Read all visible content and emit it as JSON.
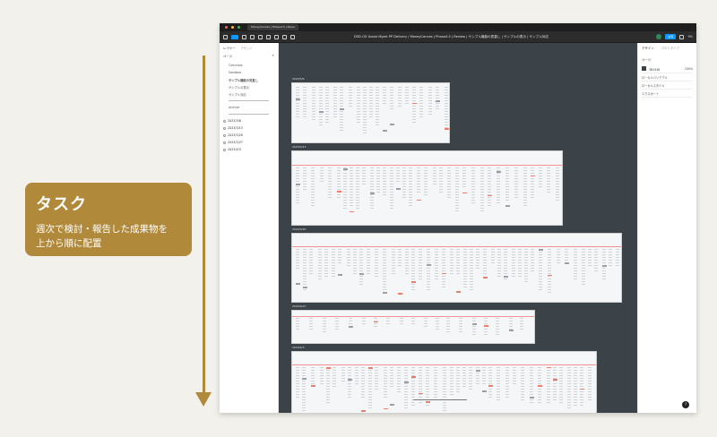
{
  "annotation": {
    "title": "タスク",
    "description_line1": "週次で検討・報告した成果物を",
    "description_line2": "上から順に配置",
    "accent_color": "#b0893a"
  },
  "window": {
    "tab_label": "MoneyCanvas | Phase4-5 | Revie",
    "file_title": "DSD-GX Assist Mgmt PP Delivery  /  MoneyCanvas | Phase4-5 | Review | サンプル機能の見直し | サンプルの表示 | サンプル対応",
    "share_label": "共有",
    "zoom": "9%"
  },
  "left_panel": {
    "tabs": [
      "レイヤー",
      "アセット"
    ],
    "active_tab": "レイヤー",
    "pages_header": "ページ",
    "add_icon": "+",
    "pages": [
      {
        "label": "Overview",
        "sub": true
      },
      {
        "label": "Sandbox",
        "sub": true
      },
      {
        "label": "サンプル機能の見直し",
        "sub": true,
        "current": true
      },
      {
        "label": "サンプルの表示",
        "sub": true
      },
      {
        "label": "サンプル対応",
        "sub": true
      }
    ],
    "archive_label": "Archive",
    "weeks": [
      "2023/3/6",
      "2023/3/13",
      "2023/3/20",
      "2023/3/27",
      "2023/4/3"
    ]
  },
  "canvas": {
    "bg_color": "#3b4348",
    "frames": [
      {
        "label": "2023/3/6"
      },
      {
        "label": "2023/3/13"
      },
      {
        "label": "2023/3/20"
      },
      {
        "label": "2023/3/27"
      },
      {
        "label": "2023/4/3"
      }
    ]
  },
  "right_panel": {
    "tabs": [
      "デザイン",
      "プロトタイプ"
    ],
    "active_tab": "デザイン",
    "page_section": "ページ",
    "bg_hex": "3B4348",
    "bg_opacity": "100%",
    "rows": [
      "ローカルバリアブル",
      "ローカルスタイル",
      "エクスポート"
    ]
  },
  "help_label": "?"
}
